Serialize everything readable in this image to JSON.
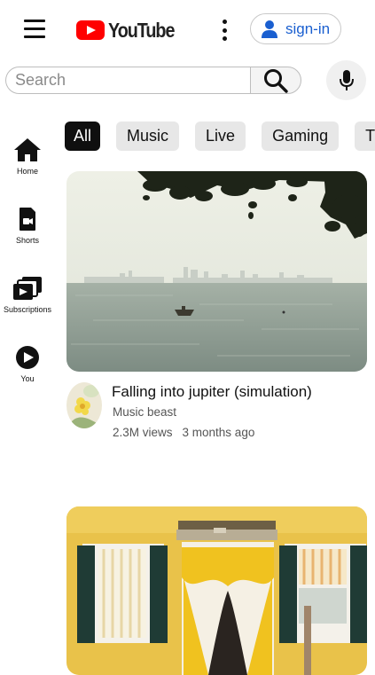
{
  "header": {
    "logo_text": "YouTube",
    "signin_label": "sign-in"
  },
  "search": {
    "placeholder": "Search",
    "value": ""
  },
  "sidebar": {
    "items": [
      {
        "label": "Home",
        "icon": "home-icon"
      },
      {
        "label": "Shorts",
        "icon": "shorts-icon"
      },
      {
        "label": "Subscriptions",
        "icon": "subscriptions-icon"
      },
      {
        "label": "You",
        "icon": "you-icon"
      }
    ]
  },
  "chips": [
    {
      "label": "All",
      "active": true
    },
    {
      "label": "Music",
      "active": false
    },
    {
      "label": "Live",
      "active": false
    },
    {
      "label": "Gaming",
      "active": false
    },
    {
      "label": "T",
      "active": false
    }
  ],
  "videos": [
    {
      "title": "Falling into jupiter (simulation)",
      "channel": "Music beast",
      "views": "2.3M views",
      "age": "3 months ago"
    }
  ],
  "colors": {
    "brand_red": "#ff0000",
    "signin_blue": "#1a5fd0",
    "chip_active": "#0f0f0f",
    "chip_bg": "#e7e7e7"
  }
}
